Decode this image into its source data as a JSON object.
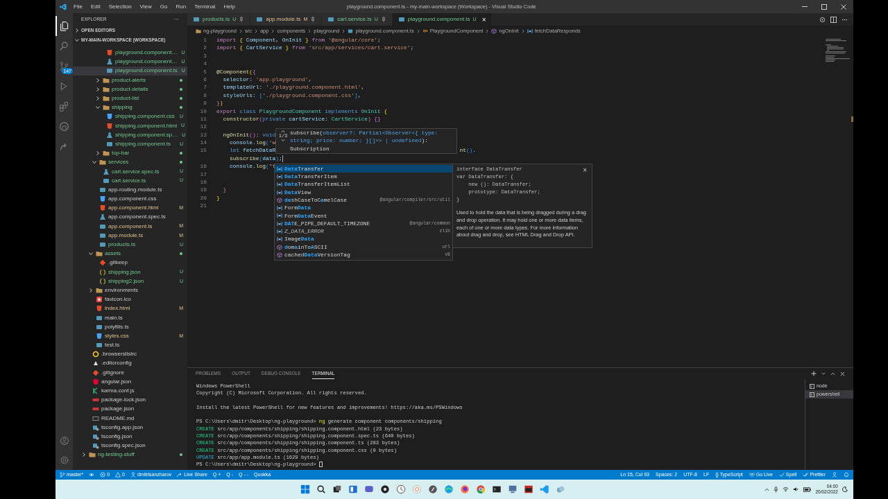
{
  "window": {
    "title": "playground.component.ts - my-main-workspace (Workspace) - Visual Studio Code"
  },
  "menu": [
    "File",
    "Edit",
    "Selection",
    "View",
    "Go",
    "Run",
    "Terminal",
    "Help"
  ],
  "activity_bar": [
    {
      "kind": "files",
      "selected": true
    },
    {
      "kind": "search",
      "selected": false
    },
    {
      "kind": "scm",
      "selected": false,
      "badge": "147"
    },
    {
      "kind": "run",
      "selected": false
    },
    {
      "kind": "extensions",
      "selected": false
    },
    {
      "kind": "github",
      "selected": false
    },
    {
      "kind": "remote",
      "selected": false
    }
  ],
  "activity_bar_bottom": [
    {
      "kind": "account"
    },
    {
      "kind": "settings"
    }
  ],
  "sidebar": {
    "title": "EXPLORER",
    "more": "···",
    "sections": [
      {
        "label": "OPEN EDITORS",
        "expanded": false
      },
      {
        "label": "MY-MAIN-WORKSPACE (WORKSPACE)",
        "expanded": true
      }
    ],
    "tree": [
      {
        "children": [
          {
            "children": [
              {
                "children": [
                  {
                    "children": [
                      {
                        "children": [
                          {
                            "label": "playground.component…",
                            "kind": "html",
                            "badge": "U",
                            "untracked": true,
                            "selected": false
                          },
                          {
                            "label": "playground.component…",
                            "kind": "spec",
                            "badge": "U",
                            "untracked": true,
                            "selected": false
                          },
                          {
                            "label": "playground.component.ts",
                            "kind": "ts",
                            "badge": "U",
                            "untracked": true,
                            "selected": true
                          }
                        ]
                      },
                      {
                        "label": "product-alerts",
                        "kind": "folder",
                        "expanded": false,
                        "untracked": true,
                        "selected": false
                      },
                      {
                        "label": "product-details",
                        "kind": "folder",
                        "expanded": false,
                        "untracked": true,
                        "selected": false
                      },
                      {
                        "label": "product-list",
                        "kind": "folder",
                        "expanded": false,
                        "untracked": true,
                        "selected": false
                      },
                      {
                        "label": "shipping",
                        "kind": "folder",
                        "expanded": true,
                        "untracked": true,
                        "selected": false,
                        "children": [
                          {
                            "label": "shipping.component.css",
                            "kind": "css",
                            "badge": "U",
                            "untracked": true,
                            "selected": false
                          },
                          {
                            "label": "shipping.component.html",
                            "kind": "html",
                            "badge": "U",
                            "untracked": true,
                            "selected": false
                          },
                          {
                            "label": "shipping.component.sp…",
                            "kind": "spec",
                            "badge": "U",
                            "untracked": true,
                            "selected": false
                          },
                          {
                            "label": "shipping.component.ts",
                            "kind": "ts",
                            "badge": "U",
                            "untracked": true,
                            "selected": false
                          }
                        ]
                      },
                      {
                        "label": "top-bar",
                        "kind": "folder",
                        "expanded": false,
                        "untracked": true,
                        "selected": false
                      }
                    ]
                  },
                  {
                    "label": "services",
                    "kind": "folder",
                    "expanded": true,
                    "untracked": true,
                    "selected": false,
                    "children": [
                      {
                        "label": "cart.service.spec.ts",
                        "kind": "spec",
                        "badge": "U",
                        "untracked": true,
                        "selected": false
                      },
                      {
                        "label": "cart.service.ts",
                        "kind": "ts",
                        "badge": "U",
                        "untracked": true,
                        "selected": false
                      }
                    ]
                  },
                  {
                    "label": "app-routing.module.ts",
                    "kind": "ts",
                    "selected": false
                  },
                  {
                    "label": "app.component.css",
                    "kind": "css",
                    "selected": false
                  },
                  {
                    "label": "app.component.html",
                    "kind": "html",
                    "badge": "M",
                    "modified": true,
                    "selected": false
                  },
                  {
                    "label": "app.component.spec.ts",
                    "kind": "spec",
                    "selected": false
                  },
                  {
                    "label": "app.component.ts",
                    "kind": "ts",
                    "badge": "M",
                    "modified": true,
                    "selected": false
                  },
                  {
                    "label": "app.module.ts",
                    "kind": "ts",
                    "badge": "M",
                    "modified": true,
                    "selected": false
                  },
                  {
                    "label": "products.ts",
                    "kind": "ts",
                    "badge": "U",
                    "untracked": true,
                    "selected": false
                  }
                ]
              },
              {
                "label": "assets",
                "kind": "folder",
                "expanded": true,
                "untracked": true,
                "selected": false,
                "children": [
                  {
                    "label": ".gitkeep",
                    "kind": "git",
                    "selected": false
                  },
                  {
                    "label": "shipping.json",
                    "kind": "json",
                    "badge": "U",
                    "untracked": true,
                    "selected": false
                  },
                  {
                    "label": "shipping2.json",
                    "kind": "json",
                    "badge": "U",
                    "untracked": true,
                    "selected": false
                  }
                ]
              },
              {
                "label": "environments",
                "kind": "folder",
                "expanded": false,
                "selected": false
              },
              {
                "label": "favicon.ico",
                "kind": "favicon",
                "selected": false
              },
              {
                "label": "index.html",
                "kind": "html",
                "badge": "M",
                "modified": true,
                "selected": false
              },
              {
                "label": "main.ts",
                "kind": "ts",
                "selected": false
              },
              {
                "label": "polyfills.ts",
                "kind": "ts",
                "selected": false
              },
              {
                "label": "styles.css",
                "kind": "css",
                "badge": "M",
                "modified": true,
                "selected": false
              },
              {
                "label": "test.ts",
                "kind": "ts",
                "selected": false
              }
            ]
          },
          {
            "label": ".browserslistrc",
            "kind": "browserslist",
            "selected": false
          },
          {
            "label": ".editorconfig",
            "kind": "editorconfig",
            "selected": false
          },
          {
            "label": ".gitignore",
            "kind": "git",
            "selected": false
          },
          {
            "label": "angular.json",
            "kind": "angular",
            "selected": false
          },
          {
            "label": "karma.conf.js",
            "kind": "karma",
            "selected": false
          },
          {
            "label": "package-lock.json",
            "kind": "npm",
            "selected": false
          },
          {
            "label": "package.json",
            "kind": "npm",
            "selected": false
          },
          {
            "label": "README.md",
            "kind": "md",
            "selected": false
          },
          {
            "label": "tsconfig.app.json",
            "kind": "tsconfig",
            "selected": false
          },
          {
            "label": "tsconfig.json",
            "kind": "tsconfig",
            "selected": false
          },
          {
            "label": "tsconfig.spec.json",
            "kind": "tsconfig",
            "selected": false
          }
        ]
      },
      {
        "label": "ng-testing-stuff",
        "kind": "folder",
        "expanded": false,
        "untracked": true,
        "selected": false
      }
    ]
  },
  "tabs": [
    {
      "label": "products.ts",
      "kind": "ts",
      "badge": "U",
      "untracked": true,
      "selected": false
    },
    {
      "label": "app.module.ts",
      "kind": "ts",
      "badge": "M",
      "modified": true,
      "selected": false
    },
    {
      "label": "cart.service.ts",
      "kind": "ts",
      "badge": "U",
      "untracked": true,
      "selected": false
    },
    {
      "label": "playground.component.ts",
      "kind": "ts",
      "badge": "U",
      "untracked": true,
      "selected": true,
      "close": "×"
    }
  ],
  "breadcrumb": [
    {
      "text": "ng-playground",
      "kind": "folder"
    },
    {
      "text": "src"
    },
    {
      "text": "app"
    },
    {
      "text": "components"
    },
    {
      "text": "playground"
    },
    {
      "text": "playground.component.ts",
      "kind": "ts"
    },
    {
      "text": "PlaygroundComponent",
      "kind": "class"
    },
    {
      "text": "ngOnInit",
      "kind": "method"
    },
    {
      "text": "fetchDataResponds",
      "kind": "variable"
    }
  ],
  "code": [
    {
      "number": "1",
      "tokens": [
        {
          "kind": "kw",
          "text": "import "
        },
        {
          "kind": "br1",
          "text": "{ "
        },
        {
          "kind": "var",
          "text": "Component"
        },
        {
          "kind": "p",
          "text": ", "
        },
        {
          "kind": "var",
          "text": "OnInit "
        },
        {
          "kind": "br1",
          "text": "} "
        },
        {
          "kind": "kw",
          "text": "from "
        },
        {
          "kind": "str",
          "text": "'@angular/core'"
        },
        {
          "kind": "p",
          "text": ";"
        }
      ]
    },
    {
      "number": "2",
      "tokens": [
        {
          "kind": "kw",
          "text": "import "
        },
        {
          "kind": "br1",
          "text": "{ "
        },
        {
          "kind": "var",
          "text": "CartService "
        },
        {
          "kind": "br1",
          "text": "} "
        },
        {
          "kind": "kw",
          "text": "from "
        },
        {
          "kind": "str",
          "text": "'src/app/services/cart.service'"
        },
        {
          "kind": "p",
          "text": ";"
        }
      ]
    },
    {
      "number": "3"
    },
    {
      "number": "4"
    },
    {
      "number": "5",
      "tokens": [
        {
          "kind": "fn",
          "text": "@Component"
        },
        {
          "kind": "br1",
          "text": "("
        },
        {
          "kind": "br2",
          "text": "{"
        }
      ]
    },
    {
      "number": "6",
      "tokens": [
        {
          "kind": "var",
          "text": "  selector"
        },
        {
          "kind": "p",
          "text": ": "
        },
        {
          "kind": "str",
          "text": "'app-playground'"
        },
        {
          "kind": "p",
          "text": ","
        }
      ]
    },
    {
      "number": "7",
      "tokens": [
        {
          "kind": "var",
          "text": "  templateUrl"
        },
        {
          "kind": "p",
          "text": ": "
        },
        {
          "kind": "str",
          "text": "'./playground.component.html'"
        },
        {
          "kind": "p",
          "text": ","
        }
      ]
    },
    {
      "number": "8",
      "tokens": [
        {
          "kind": "var",
          "text": "  styleUrls"
        },
        {
          "kind": "p",
          "text": ": "
        },
        {
          "kind": "br3",
          "text": "["
        },
        {
          "kind": "str",
          "text": "'./playground.component.css'"
        },
        {
          "kind": "br3",
          "text": "]"
        },
        {
          "kind": "p",
          "text": ","
        }
      ]
    },
    {
      "number": "9",
      "tokens": [
        {
          "kind": "br2",
          "text": "}"
        },
        {
          "kind": "br1",
          "text": ")"
        }
      ]
    },
    {
      "number": "10",
      "tokens": [
        {
          "kind": "kw",
          "text": "export "
        },
        {
          "kind": "kw2",
          "text": "class "
        },
        {
          "kind": "type",
          "text": "PlaygroundComponent "
        },
        {
          "kind": "kw2",
          "text": "implements "
        },
        {
          "kind": "type",
          "text": "OnInit "
        },
        {
          "kind": "br1",
          "text": "{"
        }
      ]
    },
    {
      "number": "11",
      "tokens": [
        {
          "kind": "fn",
          "text": "  constructor"
        },
        {
          "kind": "br2",
          "text": "("
        },
        {
          "kind": "kw2",
          "text": "private "
        },
        {
          "kind": "var",
          "text": "cartService"
        },
        {
          "kind": "p",
          "text": ": "
        },
        {
          "kind": "type",
          "text": "CartService"
        },
        {
          "kind": "br2",
          "text": ") {}"
        }
      ]
    },
    {
      "number": "12"
    },
    {
      "number": "13",
      "tokens": [
        {
          "kind": "fn",
          "text": "  ngOnInit"
        },
        {
          "kind": "br2",
          "text": "()"
        },
        {
          "kind": "p",
          "text": ": "
        },
        {
          "kind": "kw2",
          "text": "void"
        }
      ]
    },
    {
      "number": "14",
      "tokens": [
        {
          "kind": "var",
          "text": "    console"
        },
        {
          "kind": "p",
          "text": "."
        },
        {
          "kind": "fn",
          "text": "log"
        },
        {
          "kind": "br3",
          "text": "("
        },
        {
          "kind": "str",
          "text": "'w"
        }
      ]
    },
    {
      "number": "15",
      "tokens": [
        {
          "kind": "kw2",
          "text": "    let "
        },
        {
          "kind": "var",
          "text": "fetchDataR"
        }
      ],
      "tail": [
        {
          "kind": "fn",
          "text": "nt"
        },
        {
          "kind": "br3",
          "text": "()"
        },
        {
          "kind": "p",
          "text": "."
        }
      ]
    },
    {
      "tokens": [
        {
          "kind": "fn",
          "text": "    subscribe"
        },
        {
          "kind": "br3",
          "text": "("
        },
        {
          "kind": "var",
          "text": "data"
        },
        {
          "kind": "br3",
          "text": ")"
        },
        {
          "kind": "p",
          "text": ";"
        }
      ],
      "cursor": true
    },
    {
      "number": "16",
      "tokens": [
        {
          "kind": "var",
          "text": "    console"
        },
        {
          "kind": "p",
          "text": "."
        },
        {
          "kind": "fn",
          "text": "log"
        },
        {
          "kind": "br3",
          "text": "("
        },
        {
          "kind": "str",
          "text": "\"f"
        }
      ]
    },
    {
      "number": "17"
    },
    {
      "number": "18"
    },
    {
      "number": "19",
      "tokens": [
        {
          "kind": "br2",
          "text": "  }"
        }
      ]
    },
    {
      "number": "20",
      "tokens": [
        {
          "kind": "br1",
          "text": "}"
        }
      ]
    },
    {
      "number": "21"
    }
  ],
  "signature_help": {
    "counter": "1/3",
    "lines": [
      [
        {
          "kind": "p",
          "text": "subscribe("
        },
        {
          "kind": "var",
          "text": "observer?: Partial<Observer<{ type:"
        }
      ],
      [
        {
          "kind": "var",
          "text": "string; price: number; }[]>> | undefined"
        },
        {
          "kind": "p",
          "text": "):"
        }
      ],
      [
        {
          "kind": "p",
          "text": "Subscription"
        }
      ]
    ]
  },
  "suggestions": {
    "items": [
      {
        "kind": "variable",
        "parts": [
          {
            "t": "Data",
            "match": true
          },
          {
            "t": "Transfer",
            "match": false
          }
        ],
        "selected": true
      },
      {
        "kind": "variable",
        "parts": [
          {
            "t": "Data",
            "match": true
          },
          {
            "t": "TransferItem",
            "match": false
          }
        ],
        "selected": false
      },
      {
        "kind": "variable",
        "parts": [
          {
            "t": "Data",
            "match": true
          },
          {
            "t": "TransferItemList",
            "match": false
          }
        ],
        "selected": false
      },
      {
        "kind": "variable",
        "parts": [
          {
            "t": "Data",
            "match": true
          },
          {
            "t": "View",
            "match": false
          }
        ],
        "selected": false
      },
      {
        "kind": "method",
        "parts": [
          {
            "t": "da",
            "match": true
          },
          {
            "t": "shCaseToC",
            "match": false
          },
          {
            "t": "a",
            "match": true
          },
          {
            "t": "melCase",
            "match": false
          }
        ],
        "source": "@angular/compiler/src/util",
        "selected": false
      },
      {
        "kind": "variable",
        "parts": [
          {
            "t": "Form",
            "match": false
          },
          {
            "t": "Data",
            "match": true
          }
        ],
        "selected": false
      },
      {
        "kind": "variable",
        "parts": [
          {
            "t": "Form",
            "match": false
          },
          {
            "t": "Data",
            "match": true
          },
          {
            "t": "Event",
            "match": false
          }
        ],
        "selected": false
      },
      {
        "kind": "variable",
        "parts": [
          {
            "t": "DAT",
            "match": true
          },
          {
            "t": "E_PIPE_DEFAULT_TIMEZONE",
            "match": false
          }
        ],
        "source": "@angular/common",
        "selected": false
      },
      {
        "kind": "variable",
        "parts": [
          {
            "t": "Z_DATA_ERROR",
            "match": false
          }
        ],
        "source": "zlib",
        "deprecated": true,
        "selected": false
      },
      {
        "kind": "variable",
        "parts": [
          {
            "t": "Image",
            "match": false
          },
          {
            "t": "Data",
            "match": true
          }
        ],
        "selected": false
      },
      {
        "kind": "method",
        "parts": [
          {
            "t": "d",
            "match": true
          },
          {
            "t": "om",
            "match": false
          },
          {
            "t": "a",
            "match": true
          },
          {
            "t": "inTo",
            "match": false
          },
          {
            "t": "A",
            "match": true
          },
          {
            "t": "SCII",
            "match": false
          }
        ],
        "source": "url",
        "selected": false
      },
      {
        "kind": "method",
        "parts": [
          {
            "t": "cached",
            "match": false
          },
          {
            "t": "Data",
            "match": true
          },
          {
            "t": "VersionTag",
            "match": false
          }
        ],
        "source": "v8",
        "selected": false
      }
    ],
    "details": {
      "signature": [
        "interface DataTransfer",
        "var DataTransfer: {",
        "    new (): DataTransfer;",
        "    prototype: DataTransfer;",
        "}"
      ],
      "description": "Used to hold the data that is being dragged during a drag and drop operation. It may hold one or more data items, each of one or more data types. For more information about drag and drop, see HTML Drag and Drop API.",
      "close": "×"
    }
  },
  "panel": {
    "tabs": [
      {
        "label": "PROBLEMS",
        "selected": false
      },
      {
        "label": "OUTPUT",
        "selected": false
      },
      {
        "label": "DEBUG CONSOLE",
        "selected": false
      },
      {
        "label": "TERMINAL",
        "selected": true
      }
    ],
    "terminal_lines": [
      {
        "tokens": [
          {
            "kind": "text",
            "text": "Windows PowerShell"
          }
        ]
      },
      {
        "tokens": [
          {
            "kind": "text",
            "text": "Copyright (C) Microsoft Corporation. All rights reserved."
          }
        ]
      },
      {
        "blank_before": true,
        "tokens": [
          {
            "kind": "text",
            "text": "Install the latest PowerShell for new features and improvements! https://aka.ms/PSWindows"
          }
        ]
      },
      {
        "blank_before": true,
        "tokens": [
          {
            "kind": "text",
            "text": "PS C:\\Users\\dmitr\\Desktop\\ng-playground> "
          },
          {
            "kind": "cmd",
            "text": "ng"
          },
          {
            "kind": "text",
            "text": " generate component components/shipping"
          }
        ]
      },
      {
        "tokens": [
          {
            "kind": "create",
            "text": "CREATE"
          },
          {
            "kind": "text",
            "text": " src/app/components/shipping/shipping.component.html (23 bytes)"
          }
        ]
      },
      {
        "tokens": [
          {
            "kind": "create",
            "text": "CREATE"
          },
          {
            "kind": "text",
            "text": " src/app/components/shipping/shipping.component.spec.ts (640 bytes)"
          }
        ]
      },
      {
        "tokens": [
          {
            "kind": "create",
            "text": "CREATE"
          },
          {
            "kind": "text",
            "text": " src/app/components/shipping/shipping.component.ts (283 bytes)"
          }
        ]
      },
      {
        "tokens": [
          {
            "kind": "create",
            "text": "CREATE"
          },
          {
            "kind": "text",
            "text": " src/app/components/shipping/shipping.component.css (0 bytes)"
          }
        ]
      },
      {
        "tokens": [
          {
            "kind": "update",
            "text": "UPDATE"
          },
          {
            "kind": "text",
            "text": " src/app/app.module.ts (1629 bytes)"
          }
        ]
      },
      {
        "tokens": [
          {
            "kind": "text",
            "text": "PS C:\\Users\\dmitr\\Desktop\\ng-playground> "
          }
        ],
        "cursor": true
      }
    ],
    "terminals": [
      {
        "label": "node",
        "selected": false
      },
      {
        "label": "powershell",
        "selected": true
      }
    ]
  },
  "status_bar": {
    "left": [
      {
        "kind": "branch",
        "text": "master*"
      },
      {
        "kind": "sync"
      },
      {
        "kind": "error",
        "text": "0"
      },
      {
        "kind": "warning",
        "text": "0"
      },
      {
        "kind": "account",
        "text": "dmitrisanzharov"
      },
      {
        "kind": "liveshare",
        "text": "Live Share"
      },
      {
        "text": "Q +"
      },
      {
        "text": "Q -"
      },
      {
        "text": "Q - -"
      },
      {
        "text": "Quokka"
      }
    ],
    "right": [
      {
        "text": "Ln 15, Col 93"
      },
      {
        "text": "Spaces: 2"
      },
      {
        "text": "UTF-8"
      },
      {
        "text": "LF"
      },
      {
        "text": "{} TypeScript"
      },
      {
        "kind": "broadcast",
        "text": "Go Live"
      },
      {
        "kind": "check",
        "text": "Spell"
      },
      {
        "kind": "checkall",
        "text": "Prettier"
      },
      {
        "kind": "person"
      },
      {
        "kind": "bell"
      }
    ]
  },
  "taskbar": {
    "time": "04:00",
    "date": "20/02/2022"
  }
}
